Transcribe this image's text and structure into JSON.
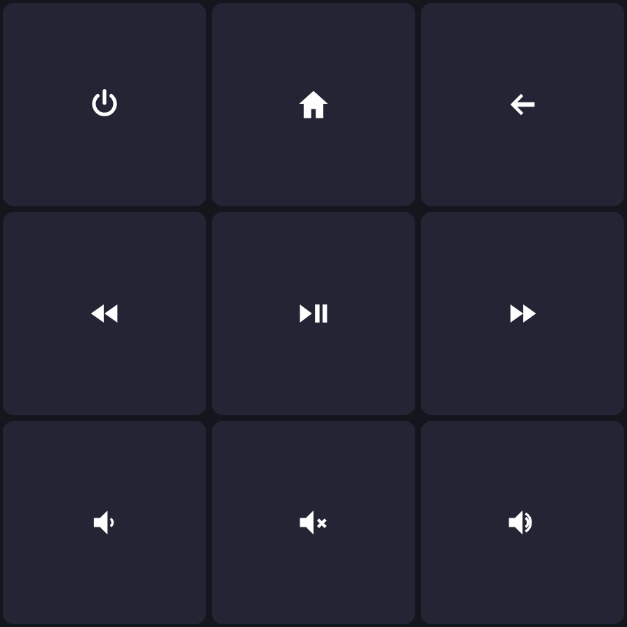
{
  "buttons": [
    {
      "kind": "power"
    },
    {
      "kind": "home"
    },
    {
      "kind": "back"
    },
    {
      "kind": "rewind"
    },
    {
      "kind": "play-pause"
    },
    {
      "kind": "fast-forward"
    },
    {
      "kind": "volume-down"
    },
    {
      "kind": "mute"
    },
    {
      "kind": "volume-up"
    }
  ]
}
